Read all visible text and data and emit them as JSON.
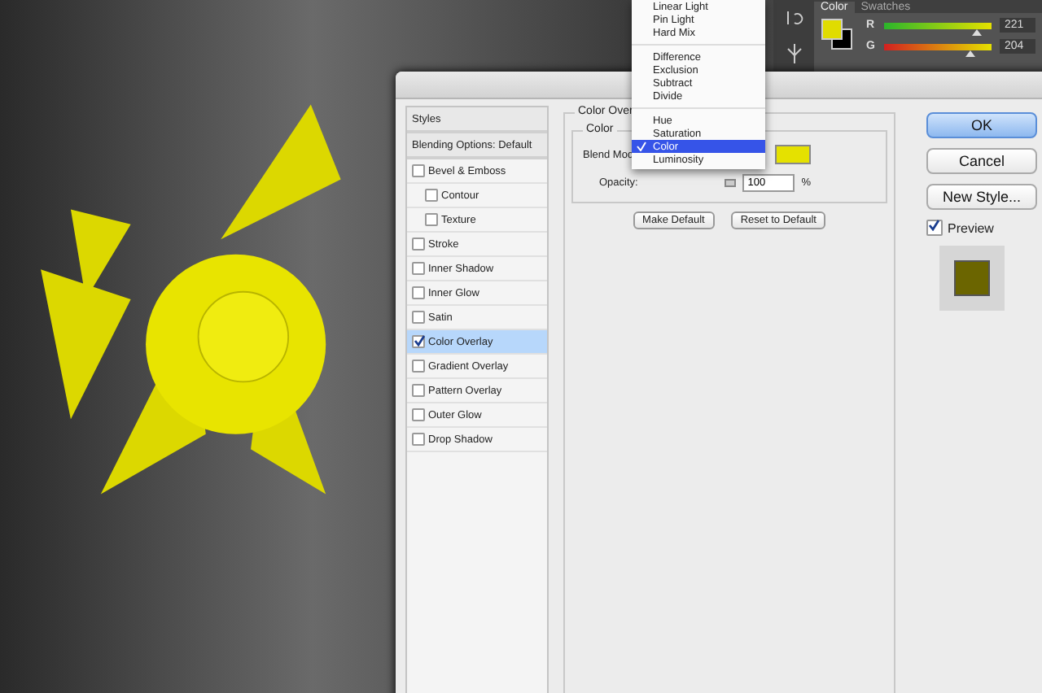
{
  "color_panel": {
    "tabs": [
      {
        "label": "Color",
        "selected": true
      },
      {
        "label": "Swatches",
        "selected": false
      }
    ],
    "sliders": [
      {
        "label": "R",
        "level": 0.87,
        "value": "221"
      },
      {
        "label": "G",
        "level": 0.8,
        "value": "204"
      }
    ]
  },
  "dialog": {
    "styles": {
      "header": "Styles",
      "blending": "Blending Options: Default",
      "items": [
        {
          "label": "Bevel & Emboss",
          "checked": false,
          "selected": false,
          "children": [
            {
              "label": "Contour",
              "checked": false,
              "selected": false
            },
            {
              "label": "Texture",
              "checked": false,
              "selected": false
            }
          ]
        },
        {
          "label": "Stroke",
          "checked": false,
          "selected": false
        },
        {
          "label": "Inner Shadow",
          "checked": false,
          "selected": false
        },
        {
          "label": "Inner Glow",
          "checked": false,
          "selected": false
        },
        {
          "label": "Satin",
          "checked": false,
          "selected": false
        },
        {
          "label": "Color Overlay",
          "checked": true,
          "selected": true
        },
        {
          "label": "Gradient Overlay",
          "checked": false,
          "selected": false
        },
        {
          "label": "Pattern Overlay",
          "checked": false,
          "selected": false
        },
        {
          "label": "Outer Glow",
          "checked": false,
          "selected": false
        },
        {
          "label": "Drop Shadow",
          "checked": false,
          "selected": false
        }
      ]
    },
    "section_title": "Color Over",
    "group_title": "Color",
    "blend_label": "Blend Mod",
    "opacity_label": "Opacity:",
    "opacity_value": "100",
    "opacity_unit": "%",
    "actions": [
      "Make Default",
      "Reset to Default"
    ],
    "buttons": [
      {
        "label": "OK",
        "default": true
      },
      {
        "label": "Cancel",
        "default": false
      },
      {
        "label": "New Style...",
        "default": false
      }
    ],
    "preview": {
      "label": "Preview",
      "checked": true
    }
  },
  "blend_menu": {
    "groups": [
      [
        {
          "label": "Linear Light",
          "selected": false
        },
        {
          "label": "Pin Light",
          "selected": false
        },
        {
          "label": "Hard Mix",
          "selected": false
        }
      ],
      [
        {
          "label": "Difference",
          "selected": false
        },
        {
          "label": "Exclusion",
          "selected": false
        },
        {
          "label": "Subtract",
          "selected": false
        },
        {
          "label": "Divide",
          "selected": false
        }
      ],
      [
        {
          "label": "Hue",
          "selected": false
        },
        {
          "label": "Saturation",
          "selected": false
        },
        {
          "label": "Color",
          "selected": true
        },
        {
          "label": "Luminosity",
          "selected": false
        }
      ]
    ]
  }
}
